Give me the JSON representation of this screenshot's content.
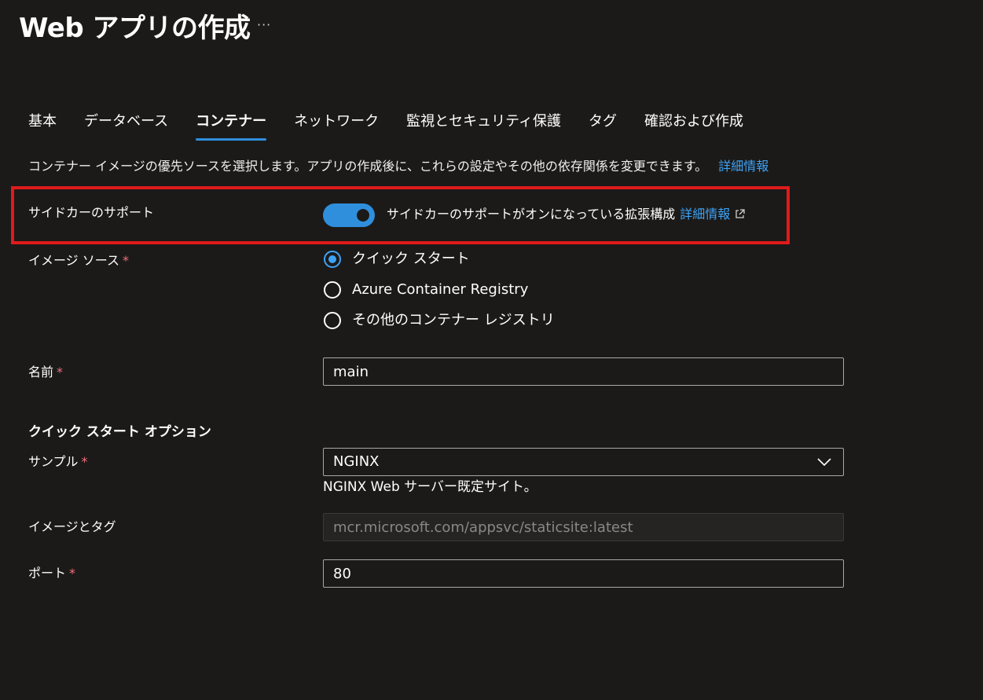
{
  "header": {
    "title": "Web アプリの作成",
    "more_label": "···"
  },
  "tabs": [
    {
      "label": "基本",
      "active": false
    },
    {
      "label": "データベース",
      "active": false
    },
    {
      "label": "コンテナー",
      "active": true
    },
    {
      "label": "ネットワーク",
      "active": false
    },
    {
      "label": "監視とセキュリティ保護",
      "active": false
    },
    {
      "label": "タグ",
      "active": false
    },
    {
      "label": "確認および作成",
      "active": false
    }
  ],
  "intro": {
    "text": "コンテナー イメージの優先ソースを選択します。アプリの作成後に、これらの設定やその他の依存関係を変更できます。",
    "link": "詳細情報"
  },
  "sidecar": {
    "label": "サイドカーのサポート",
    "enabled": true,
    "description": "サイドカーのサポートがオンになっている拡張構成",
    "link": "詳細情報"
  },
  "image_source": {
    "label": "イメージ ソース",
    "required_mark": "*",
    "options": [
      {
        "label": "クイック スタート",
        "selected": true
      },
      {
        "label": "Azure Container Registry",
        "selected": false
      },
      {
        "label": "その他のコンテナー レジストリ",
        "selected": false
      }
    ]
  },
  "name": {
    "label": "名前",
    "required_mark": "*",
    "value": "main"
  },
  "quickstart": {
    "heading": "クイック スタート オプション",
    "sample": {
      "label": "サンプル",
      "required_mark": "*",
      "value": "NGINX",
      "helper": "NGINX Web サーバー既定サイト。"
    },
    "image_tag": {
      "label": "イメージとタグ",
      "value": "mcr.microsoft.com/appsvc/staticsite:latest"
    },
    "port": {
      "label": "ポート",
      "required_mark": "*",
      "value": "80"
    }
  },
  "colors": {
    "background": "#1b1a19",
    "accent": "#2f8fdd",
    "link": "#3ea3f5",
    "highlight_border": "#e01b1b",
    "required": "#f1707b"
  }
}
